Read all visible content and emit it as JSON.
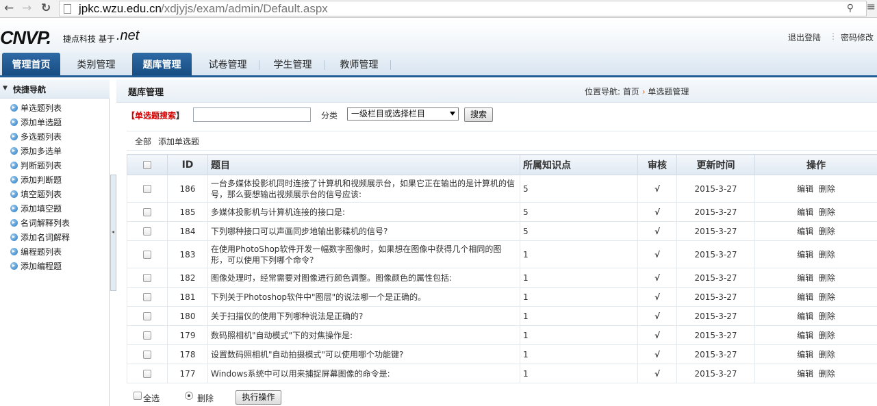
{
  "browser": {
    "back_icon": "arrow-left-icon",
    "forward_icon": "arrow-right-icon",
    "reload_icon": "reload-icon",
    "url_host": "jpkc.wzu.edu.cn",
    "url_path": "/xdjyjs/exam/admin/Default.aspx"
  },
  "header": {
    "logo_mark": "CNVP.",
    "logo_text": "捷点科技 基于",
    "logo_net": ".net",
    "logout": "退出登陆",
    "separator": "⋮",
    "change_password": "密码修改"
  },
  "tabs": [
    {
      "label": "管理首页",
      "active": false
    },
    {
      "label": "类别管理",
      "active": false
    },
    {
      "label": "题库管理",
      "active": true
    },
    {
      "label": "试卷管理",
      "active": false
    },
    {
      "label": "学生管理",
      "active": false
    },
    {
      "label": "教师管理",
      "active": false
    }
  ],
  "sidebar": {
    "title": "快捷导航",
    "items": [
      {
        "label": "单选题列表"
      },
      {
        "label": "添加单选题"
      },
      {
        "label": "多选题列表"
      },
      {
        "label": "添加多选单"
      },
      {
        "label": "判断题列表"
      },
      {
        "label": "添加判断题"
      },
      {
        "label": "填空题列表"
      },
      {
        "label": "添加填空题"
      },
      {
        "label": "名词解释列表"
      },
      {
        "label": "添加名词解释"
      },
      {
        "label": "编程题列表"
      },
      {
        "label": "添加编程题"
      }
    ]
  },
  "main": {
    "title": "题库管理",
    "breadcrumb": {
      "prefix": "位置导航:",
      "home": "首页",
      "arrow": "›",
      "current": "单选题管理"
    }
  },
  "search": {
    "bracket_open": "【",
    "label": "单选题搜索",
    "bracket_close": "】",
    "input_value": "",
    "category_label": "分类",
    "category_selected": "一级栏目或选择栏目",
    "button": "搜索"
  },
  "filter": {
    "all": "全部",
    "add": "添加单选题"
  },
  "table": {
    "headers": {
      "id": "ID",
      "title": "题目",
      "knowledge": "所属知识点",
      "audit": "审核",
      "updated": "更新时间",
      "actions": "操作"
    },
    "edit_label": "编辑",
    "delete_label": "删除",
    "rows": [
      {
        "id": "186",
        "title": "一台多媒体投影机同时连接了计算机和视频展示台，如果它正在输出的是计算机的信号，那么要想输出视频展示台的信号应该:",
        "knowledge": "5",
        "audit": "√",
        "updated": "2015-3-27"
      },
      {
        "id": "185",
        "title": "多媒体投影机与计算机连接的接口是:",
        "knowledge": "5",
        "audit": "√",
        "updated": "2015-3-27"
      },
      {
        "id": "184",
        "title": "下列哪种接口可以声画同步地输出影碟机的信号?",
        "knowledge": "5",
        "audit": "√",
        "updated": "2015-3-27"
      },
      {
        "id": "183",
        "title": "在使用PhotoShop软件开发一幅数字图像时，如果想在图像中获得几个相同的图形，可以使用下列哪个命令?",
        "knowledge": "1",
        "audit": "√",
        "updated": "2015-3-27"
      },
      {
        "id": "182",
        "title": "图像处理时，经常需要对图像进行颜色调整。图像颜色的属性包括:",
        "knowledge": "1",
        "audit": "√",
        "updated": "2015-3-27"
      },
      {
        "id": "181",
        "title": "下列关于Photoshop软件中\"图层\"的说法哪一个是正确的。",
        "knowledge": "1",
        "audit": "√",
        "updated": "2015-3-27"
      },
      {
        "id": "180",
        "title": "关于扫描仪的使用下列哪种说法是正确的?",
        "knowledge": "1",
        "audit": "√",
        "updated": "2015-3-27"
      },
      {
        "id": "179",
        "title": "数码照相机\"自动模式\"下的对焦操作是:",
        "knowledge": "1",
        "audit": "√",
        "updated": "2015-3-27"
      },
      {
        "id": "178",
        "title": "设置数码照相机\"自动拍摄模式\"可以使用哪个功能键?",
        "knowledge": "1",
        "audit": "√",
        "updated": "2015-3-27"
      },
      {
        "id": "177",
        "title": "Windows系统中可以用来捕捉屏幕图像的命令是:",
        "knowledge": "1",
        "audit": "√",
        "updated": "2015-3-27"
      }
    ]
  },
  "footer": {
    "select_all": "全选",
    "delete_option": "删除",
    "execute_button": "执行操作"
  },
  "colors": {
    "accent": "#1f5c96",
    "check_green": "#1aa01a",
    "search_red": "#d40000",
    "crumb_arrow": "#e07020"
  }
}
